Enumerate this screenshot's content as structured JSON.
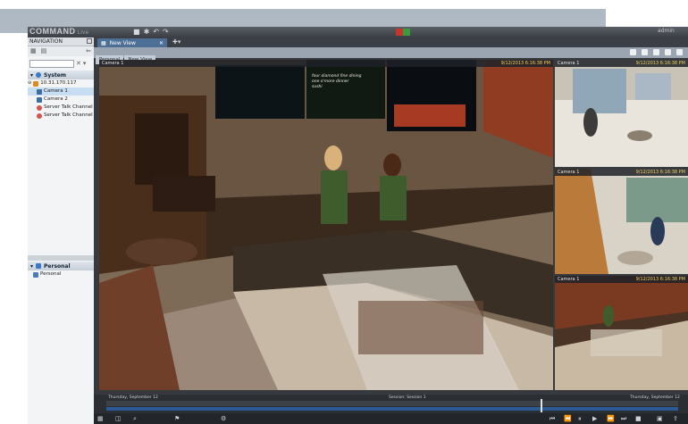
{
  "app": {
    "logo": "COMMAND",
    "edition": "Live",
    "user": "admin"
  },
  "nav": {
    "header": "NAVIGATION",
    "system_section": "System",
    "tree": [
      {
        "label": "10.31.170.117"
      },
      {
        "label": "Camera 1"
      },
      {
        "label": "Camera 2"
      },
      {
        "label": "Server Talk Channel"
      },
      {
        "label": "Server Talk Channel"
      }
    ],
    "personal_section": "Personal",
    "personal_items": [
      {
        "label": "Personal"
      }
    ]
  },
  "tabs": [
    {
      "label": "New View"
    }
  ],
  "breadcrumb": [
    "Personal",
    "New View"
  ],
  "cameras": [
    {
      "name": "Camera 1",
      "timestamp": "9/12/2013 6:16:38 PM"
    },
    {
      "name": "Camera 1",
      "timestamp": "9/12/2013 6:16:38 PM"
    },
    {
      "name": "Camera 1",
      "timestamp": "9/12/2013 6:16:38 PM"
    },
    {
      "name": "Camera 1",
      "timestamp": "9/12/2013 6:16:38 PM"
    }
  ],
  "timeline": {
    "left_label": "Thursday, September 12",
    "center_label": "Session: Session 1",
    "right_label": "Thursday, September 12",
    "cursor_fraction": 0.76
  },
  "menu_board": {
    "line1": "four diamond fine dining",
    "line2": "one o'more dinner",
    "line3": "sushi"
  }
}
